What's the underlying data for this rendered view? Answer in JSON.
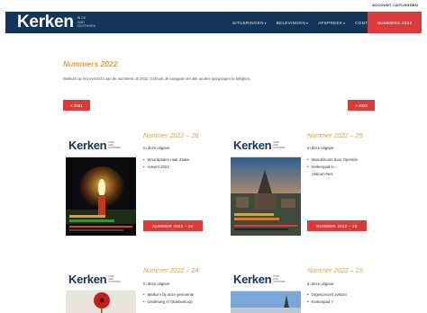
{
  "top": {
    "account_link": "ACCOUNT / UITLOGGEN"
  },
  "header": {
    "logo": "Kerken",
    "logo_sub": [
      "IN DE",
      "ZUID",
      "OOSTHOEK"
    ],
    "nav": [
      {
        "label": "SITUERINGEN",
        "caret": "▾"
      },
      {
        "label": "BELEVINGEN",
        "caret": "▾"
      },
      {
        "label": "AFSPREEK",
        "caret": "▾"
      },
      {
        "label": "CONTACT",
        "caret": "▾"
      }
    ],
    "active_nav": "NUMMERS 2022"
  },
  "page": {
    "title": "Nummers 2022",
    "intro": "Welkom op het overzicht van de nummers uit 2022. Gebruik de navigatie om alle andere jaargangen te bekijken."
  },
  "pager": {
    "prev": "< 2021",
    "next": "> 2023"
  },
  "items": [
    {
      "cover_word": "Kerken",
      "cover_sub": [
        "IN DE",
        "ZUID",
        "OOSTHOEK"
      ],
      "title": "Nummer 2022 – 26",
      "subtitle": "In deze uitgave:",
      "bullets": [
        {
          "text": "Woordpaden naar Zaate"
        },
        {
          "text": "Advent 2022"
        }
      ],
      "button": "NUMMER 2022 – 26",
      "cover_theme": "candle"
    },
    {
      "cover_word": "Kerken",
      "cover_sub": [
        "IN DE",
        "ZUID",
        "OOSTHOEK"
      ],
      "title": "Nummer 2022 – 25",
      "subtitle": "In deze uitgave:",
      "bullets": [
        {
          "text": "Wandelroute door Opeinde"
        },
        {
          "text": "Kerkenpad in –"
        },
        {
          "text": "Akkrum-Nes",
          "cont": true
        }
      ],
      "button": "NUMMER 2022 – 25",
      "cover_theme": "church"
    },
    {
      "cover_word": "Kerken",
      "cover_sub": [
        "IN DE",
        "ZUID",
        "OOSTHOEK"
      ],
      "title": "Nummer 2022 – 24",
      "subtitle": "In deze uitgave:",
      "bullets": [
        {
          "text": "Welkom bij onze gemeente"
        },
        {
          "text": "Onderweg in Oldeberkoop"
        }
      ],
      "button": "",
      "cover_theme": "poppy"
    },
    {
      "cover_word": "Kerken",
      "cover_sub": [
        "IN DE",
        "ZUID",
        "OOSTHOEK"
      ],
      "title": "Nummer 2022 – 23",
      "subtitle": "In deze uitgave:",
      "bullets": [
        {
          "text": "Orgelconcert Jelsum"
        },
        {
          "text": "Kerkenpad 7"
        }
      ],
      "button": "",
      "cover_theme": "tower"
    }
  ],
  "colors": {
    "navy": "#14355a",
    "accent_red": "#d93b3b",
    "title_gold": "#e0a12a"
  }
}
